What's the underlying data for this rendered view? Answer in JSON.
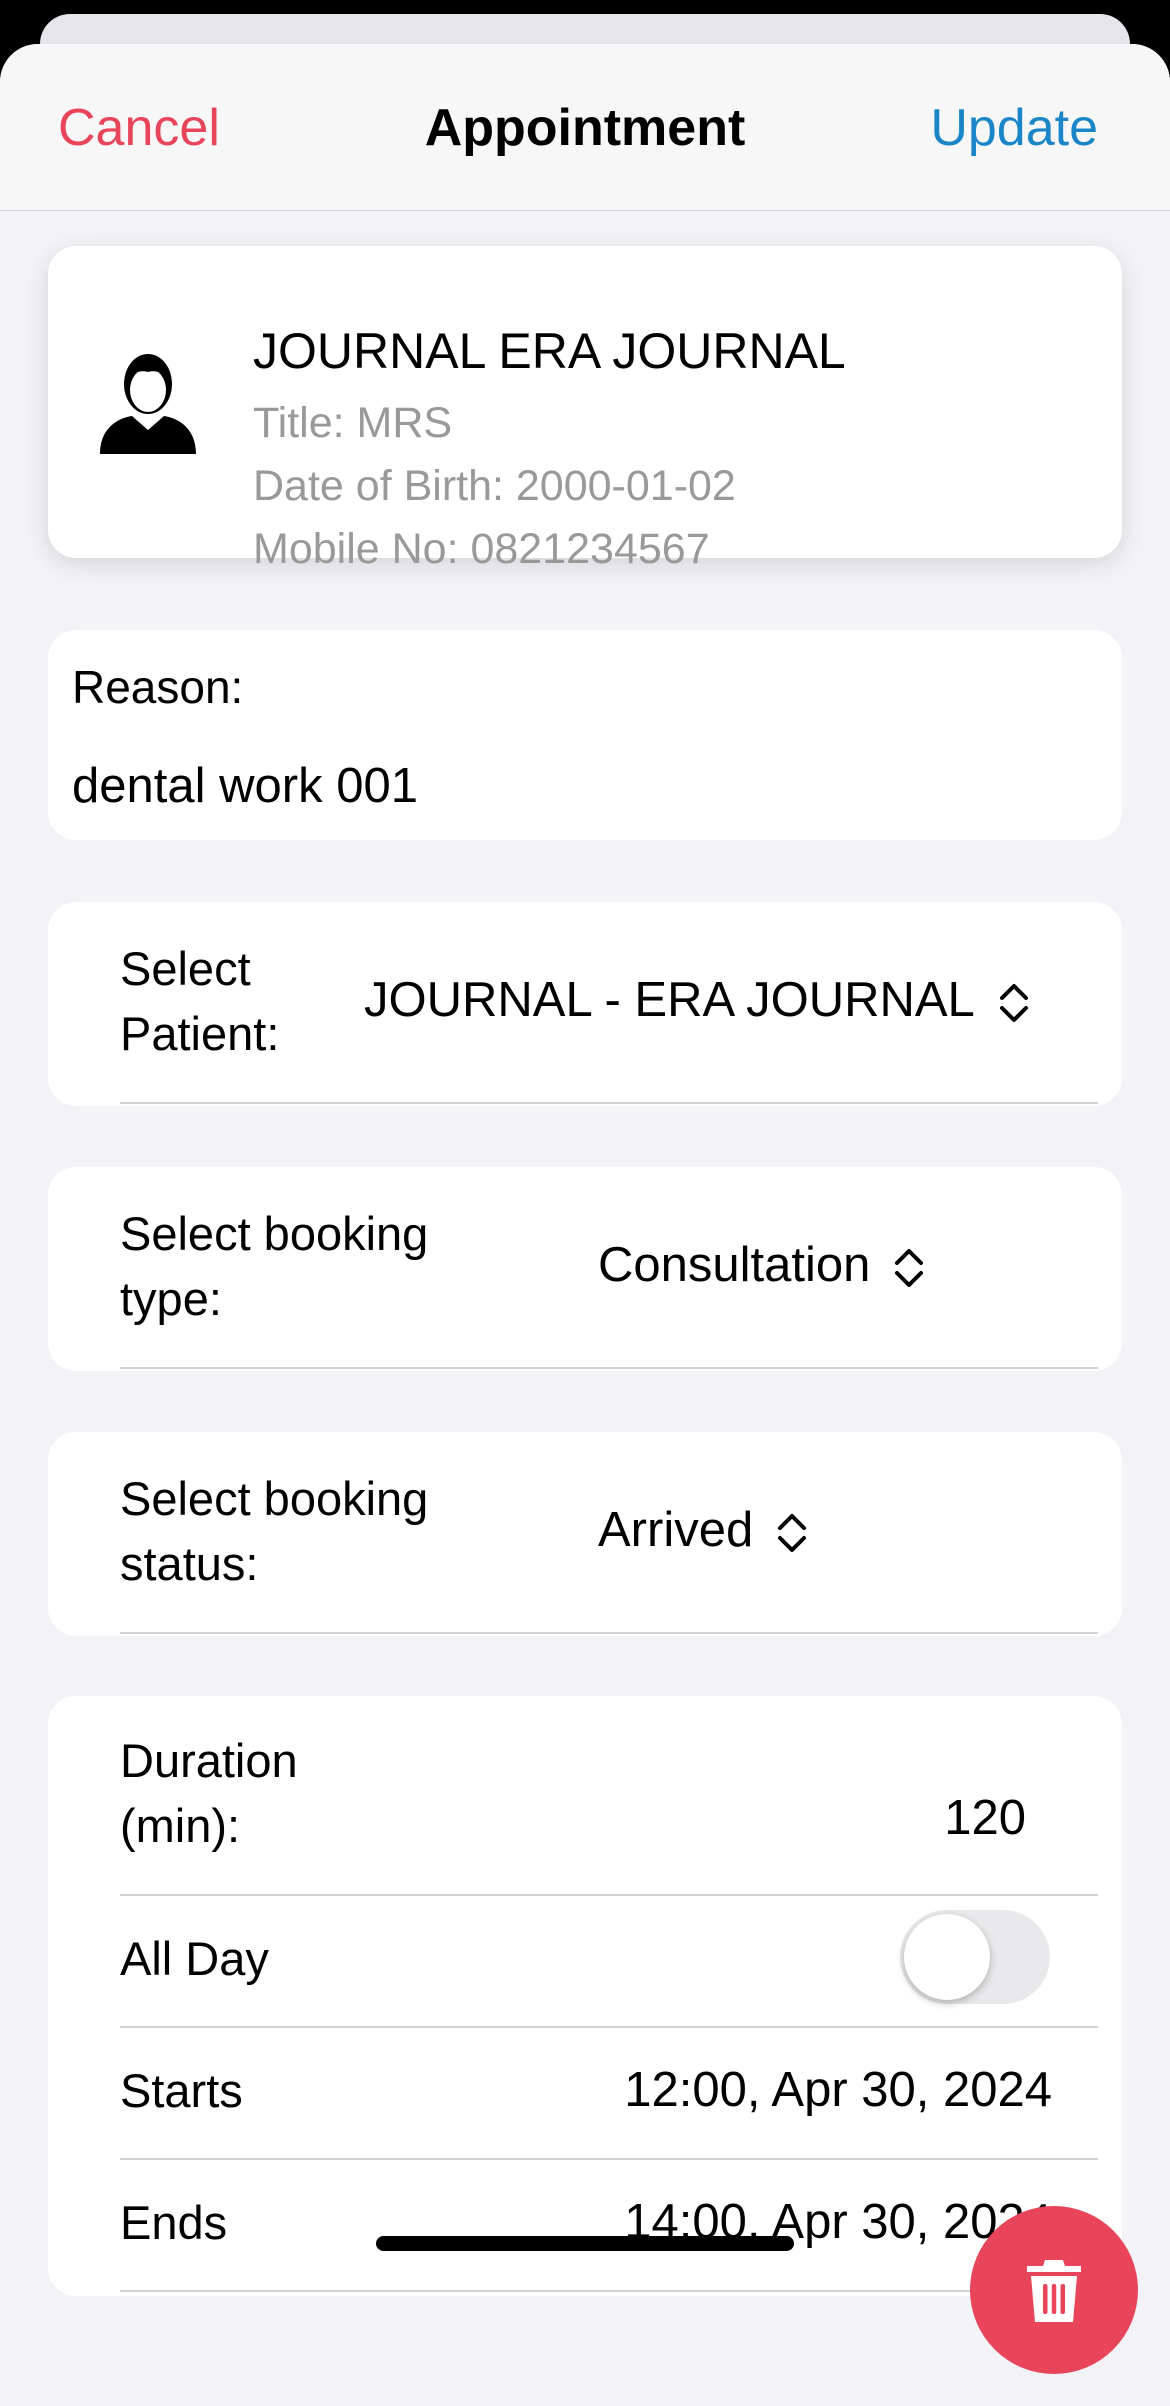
{
  "nav": {
    "cancel": "Cancel",
    "title": "Appointment",
    "update": "Update"
  },
  "patient": {
    "name": "JOURNAL ERA JOURNAL",
    "title": "Title: MRS",
    "dob": "Date of Birth: 2000-01-02",
    "mobile": "Mobile No: 0821234567",
    "icon": "person-icon"
  },
  "reason": {
    "label": "Reason:",
    "value": "dental work 001"
  },
  "select_patient": {
    "label_line1": "Select",
    "label_line2": "Patient:",
    "value": "JOURNAL - ERA JOURNAL"
  },
  "booking_type": {
    "label_line1": "Select booking",
    "label_line2": "type:",
    "value": "Consultation"
  },
  "booking_status": {
    "label_line1": "Select booking",
    "label_line2": "status:",
    "value": "Arrived"
  },
  "duration": {
    "label_line1": "Duration",
    "label_line2": "(min):",
    "value": "120"
  },
  "all_day": {
    "label": "All Day",
    "on": false
  },
  "starts": {
    "label": "Starts",
    "value": "12:00, Apr 30, 2024"
  },
  "ends": {
    "label": "Ends",
    "value": "14:00, Apr 30, 2024"
  },
  "delete_icon": "trash-icon",
  "colors": {
    "accent_red": "#e8445a",
    "accent_blue": "#1a86c8",
    "background": "#f2f2f7"
  }
}
